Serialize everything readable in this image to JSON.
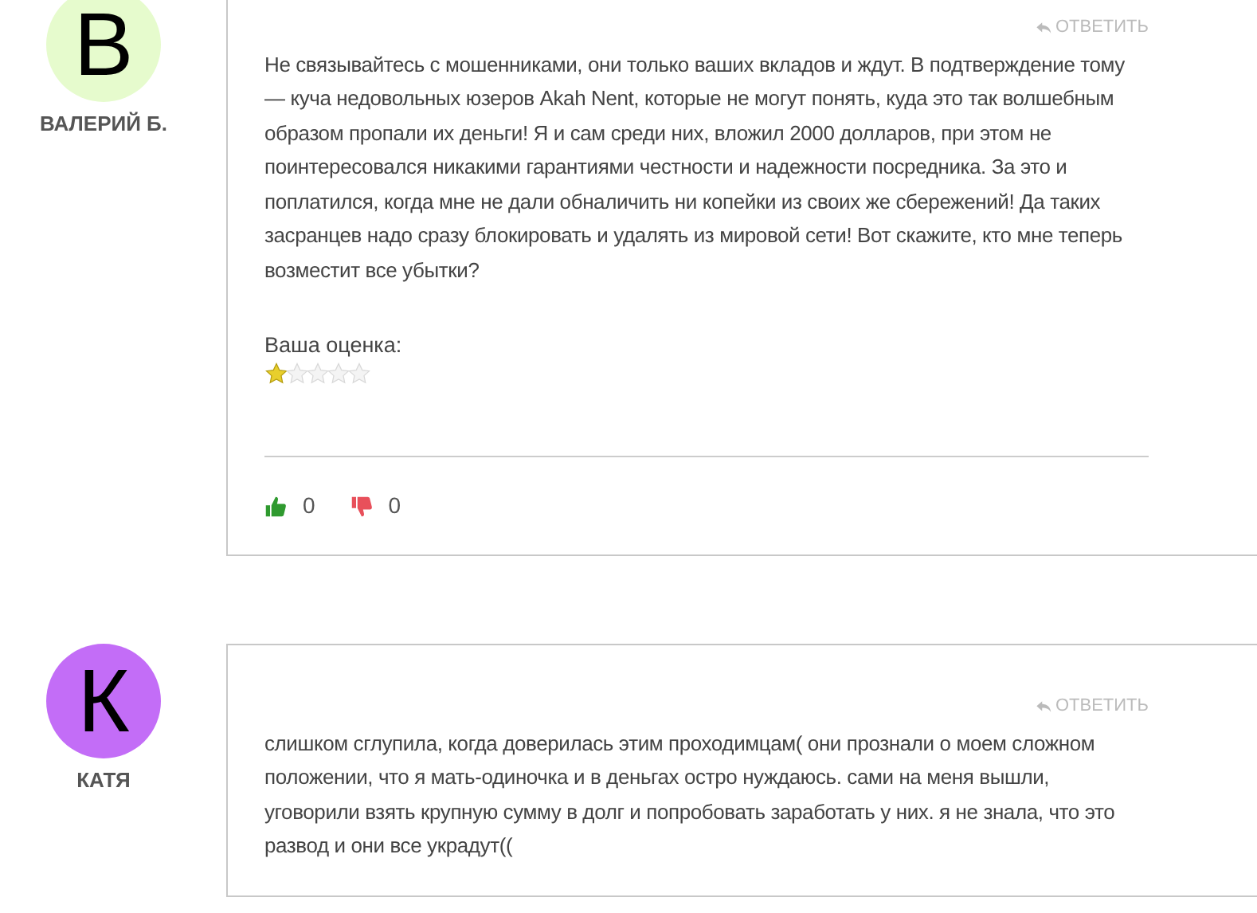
{
  "comments": [
    {
      "author": "ВАЛЕРИЙ Б.",
      "initial": "В",
      "color": "#e6fbcd",
      "reply": "ОТВЕТИТЬ",
      "text": "Не связывайтесь с мошенниками, они только ваших вкладов и ждут. В подтверждение тому — куча недовольных юзеров Akah Nent, которые не могут понять, куда это так волшебным образом пропали их деньги! Я и сам среди них, вложил 2000 долларов, при этом не поинтересовался никакими гарантиями честности и надежности посредника. За это и поплатился, когда мне не дали обналичить ни копейки из своих же сбережений! Да таких засранцев надо сразу блокировать и удалять из мировой сети! Вот скажите, кто мне теперь возместит все убытки?",
      "rating": {
        "label": "Ваша оценка:",
        "stars": 1
      },
      "likes": "0",
      "dislikes": "0"
    },
    {
      "author": "КАТЯ",
      "initial": "К",
      "color": "#c36df7",
      "reply": "ОТВЕТИТЬ",
      "text": "слишком сглупила, когда доверилась этим проходимцам( они прознали о моем сложном положении, что я мать-одиночка и в деньгах остро нуждаюсь. сами на меня вышли, уговорили взять крупную сумму в долг и попробовать заработать у них. я не знала, что это развод и они все украдут(("
    }
  ]
}
